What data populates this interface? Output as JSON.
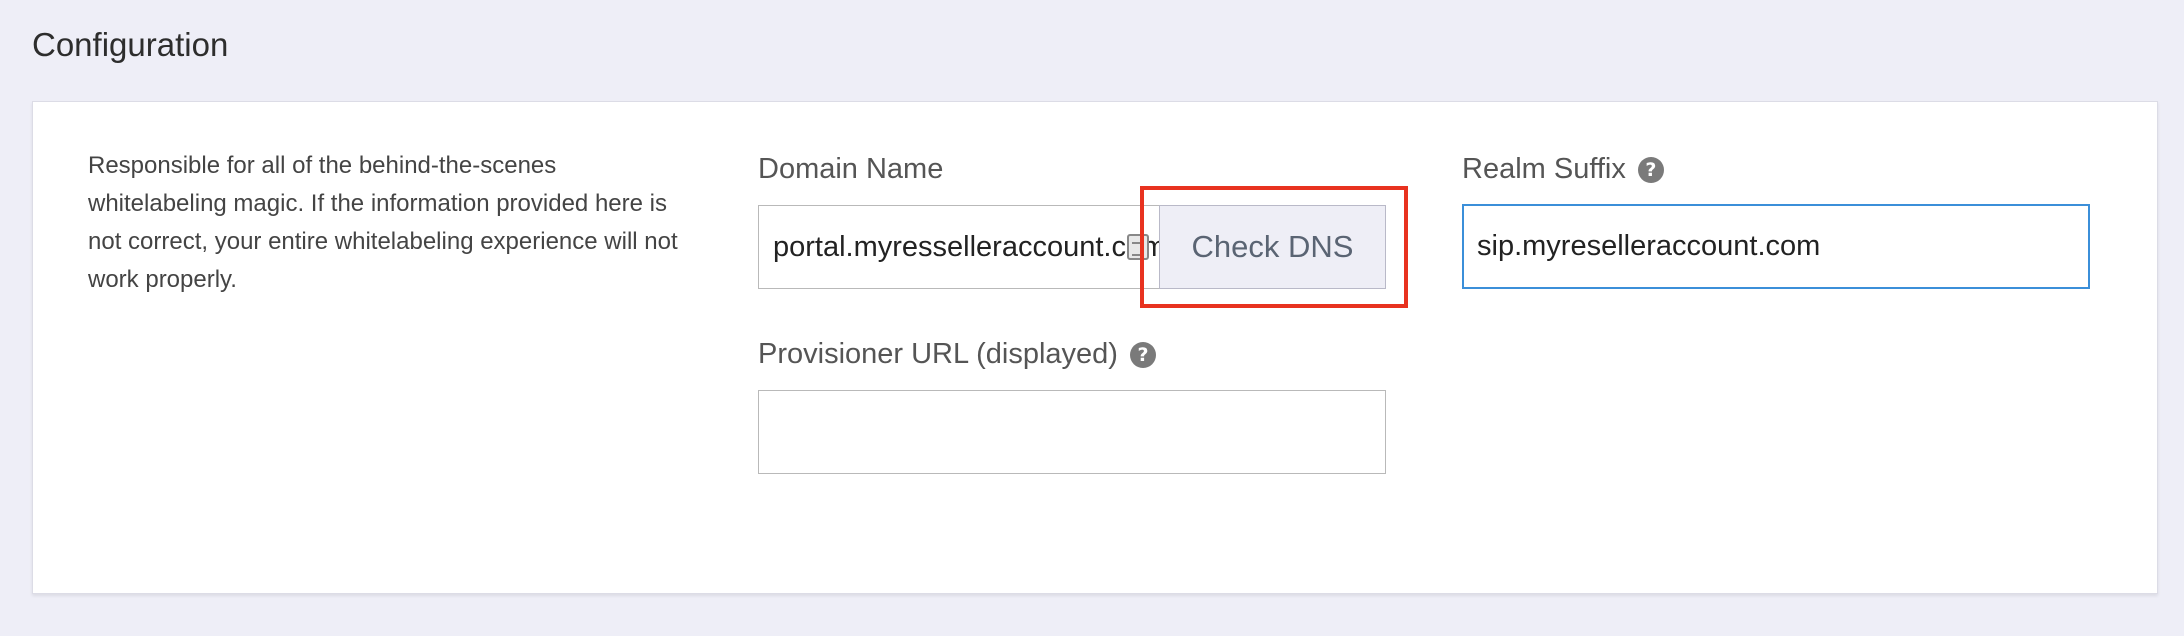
{
  "section": {
    "title": "Configuration",
    "description": "Responsible for all of the behind-the-scenes whitelabeling magic. If the information provided here is not correct, your entire whitelabeling experience will not work properly."
  },
  "domain_name": {
    "label": "Domain Name",
    "value": "portal.myresselleraccount.com",
    "button_label": "Check DNS"
  },
  "realm_suffix": {
    "label": "Realm Suffix",
    "value": "sip.myreselleraccount.com"
  },
  "provisioner_url": {
    "label": "Provisioner URL (displayed)",
    "value": ""
  },
  "icons": {
    "help": "?"
  },
  "colors": {
    "highlight": "#e8321f",
    "focus": "#3b8fd9",
    "background": "#eeeef7"
  }
}
